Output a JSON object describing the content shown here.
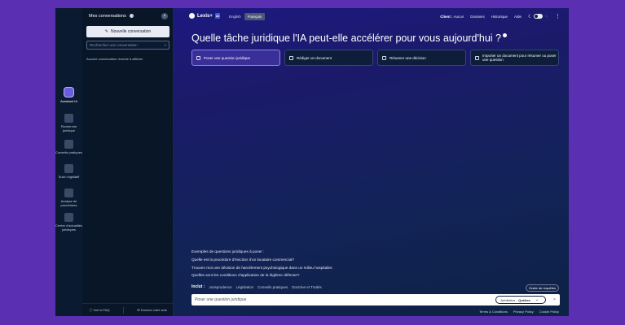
{
  "rail": {
    "items": [
      {
        "label": "Assistant IA",
        "icon": "assistant-icon",
        "active": true
      },
      {
        "label": "Recherche juridique",
        "icon": "research-icon"
      },
      {
        "label": "Conseils pratiques",
        "icon": "tips-icon"
      },
      {
        "label": "Suivi Législatif",
        "icon": "legislative-icon"
      },
      {
        "label": "Analyse de procédures",
        "icon": "analysis-icon"
      },
      {
        "label": "Centre d'actualités juridiques",
        "icon": "news-icon"
      }
    ]
  },
  "panel": {
    "title": "Mes conversations",
    "close_label": "×",
    "new_conversation": "Nouvelle conversation",
    "search_placeholder": "Rechercher une conversation",
    "empty_message": "Aucune conversation récente à afficher",
    "footer": {
      "faq": "Voir la FAQ",
      "feedback": "Donnez votre avis"
    }
  },
  "topbar": {
    "brand": "Lexis+",
    "brand_badge": "AI",
    "languages": [
      "English",
      "Français"
    ],
    "active_language": "Français",
    "client_label": "Client :",
    "client_value": "Aucun",
    "nav": [
      "Dossiers",
      "Historique",
      "Aide"
    ]
  },
  "main": {
    "heading": "Quelle tâche juridique l'IA peut-elle accélérer pour vous aujourd'hui ?",
    "actions": [
      "Poser une question juridique",
      "Rédiger un document",
      "Résumer une décision",
      "Importer un document pour résumer ou poser une question"
    ],
    "examples_title": "Exemples de questions juridiques à poser :",
    "examples": [
      "Quelle est la procédure d'éviction d'un locataire commercial?",
      "Trouvez-moi une décision de harcèlement psychologique dans un milieu hospitalier.",
      "Quelles sont les conditions d'application de la légitime défense?"
    ],
    "includes_label": "Inclut :",
    "includes": [
      "Jurisprudence",
      "Législation",
      "Conseils pratiques",
      "Doctrine et Traités"
    ],
    "guide_label": "Guide de requêtes",
    "query_placeholder": "Poser une question juridique",
    "jurisdiction_label": "Juridiction :",
    "jurisdiction_value": "Québec",
    "footer_links": [
      "Terms & Conditions",
      "Privacy Policy",
      "Cookie Policy"
    ]
  },
  "colors": {
    "background": "#5b2fb2",
    "accent": "#3a2f99",
    "panel": "#081628"
  }
}
